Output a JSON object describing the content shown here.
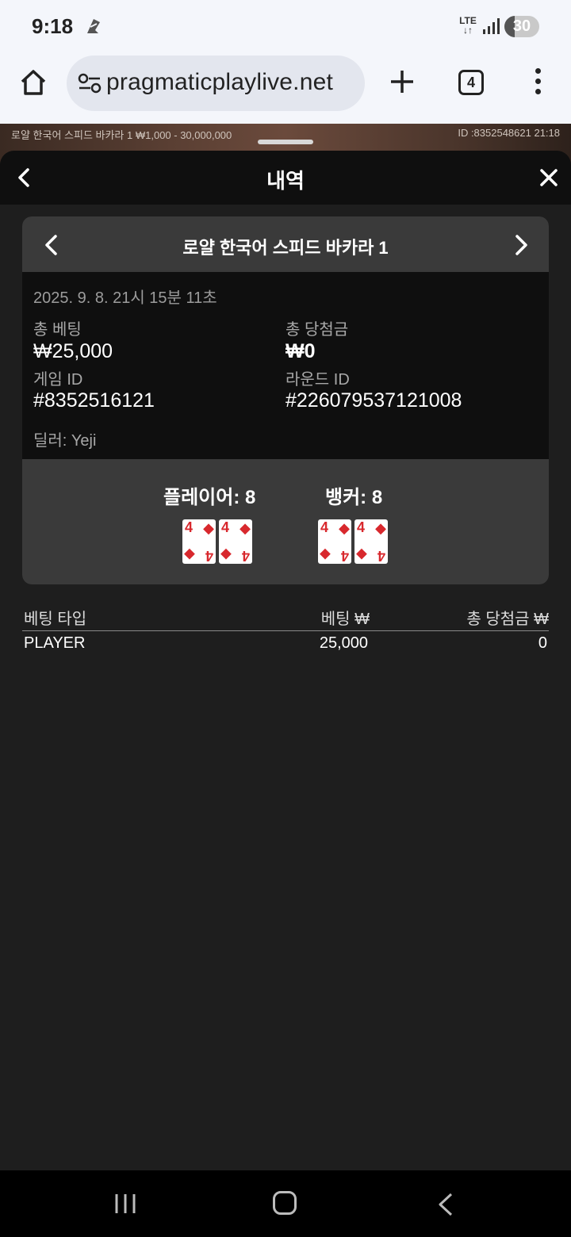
{
  "status_bar": {
    "time": "9:18",
    "network": "LTE",
    "battery": "30",
    "battery_fraction": 0.3
  },
  "browser": {
    "url": "pragmaticplaylive.net",
    "tab_count": "4"
  },
  "game_strip": {
    "left_text": "로얄 한국어 스피드 바카라 1 ₩1,000 - 30,000,000",
    "right_text": "ID :8352548621 21:18"
  },
  "sheet": {
    "title": "내역"
  },
  "round": {
    "table_name": "로얄 한국어 스피드 바카라 1",
    "datetime": "2025. 9. 8. 21시 15분 11초",
    "total_bet_label": "총 베팅",
    "total_bet_value": "₩25,000",
    "total_win_label": "총 당첨금",
    "total_win_value": "₩0",
    "game_id_label": "게임 ID",
    "game_id_value": "#8352516121",
    "round_id_label": "라운드 ID",
    "round_id_value": "#226079537121008",
    "dealer": "딜러: Yeji"
  },
  "result": {
    "player_label": "플레이어: 8",
    "banker_label": "뱅커: 8",
    "player_cards": [
      {
        "rank": "4",
        "suit": "◆"
      },
      {
        "rank": "4",
        "suit": "◆"
      }
    ],
    "banker_cards": [
      {
        "rank": "4",
        "suit": "◆"
      },
      {
        "rank": "4",
        "suit": "◆"
      }
    ],
    "card_color": "#d8282d"
  },
  "bets_table": {
    "headers": [
      "베팅 타입",
      "베팅 ₩",
      "총 당첨금 ₩"
    ],
    "rows": [
      [
        "PLAYER",
        "25,000",
        "0"
      ]
    ]
  }
}
